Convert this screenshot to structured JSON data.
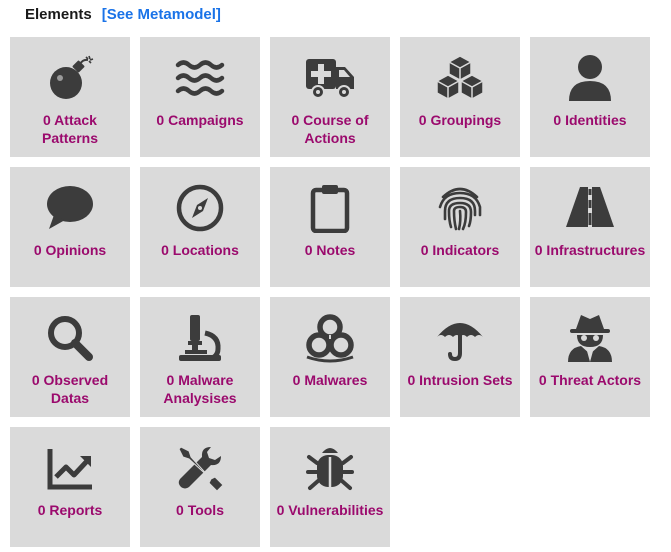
{
  "header": {
    "title": "Elements",
    "metamodel_link": "[See Metamodel]"
  },
  "tiles": [
    {
      "label": "0 Attack\nPatterns",
      "icon": "bomb-icon"
    },
    {
      "label": "0 Campaigns",
      "icon": "waves-icon"
    },
    {
      "label": "0 Course of\nActions",
      "icon": "ambulance-icon"
    },
    {
      "label": "0 Groupings",
      "icon": "cubes-icon"
    },
    {
      "label": "0 Identities",
      "icon": "user-icon"
    },
    {
      "label": "0 Opinions",
      "icon": "speech-bubble-icon"
    },
    {
      "label": "0 Locations",
      "icon": "compass-icon"
    },
    {
      "label": "0 Notes",
      "icon": "clipboard-icon"
    },
    {
      "label": "0 Indicators",
      "icon": "fingerprint-icon"
    },
    {
      "label": "0 Infrastructures",
      "icon": "road-icon"
    },
    {
      "label": "0 Observed\nDatas",
      "icon": "magnifier-icon"
    },
    {
      "label": "0 Malware\nAnalysises",
      "icon": "microscope-icon"
    },
    {
      "label": "0 Malwares",
      "icon": "biohazard-icon"
    },
    {
      "label": "0 Intrusion Sets",
      "icon": "umbrella-icon"
    },
    {
      "label": "0 Threat Actors",
      "icon": "spy-icon"
    },
    {
      "label": "0 Reports",
      "icon": "chart-line-icon"
    },
    {
      "label": "0 Tools",
      "icon": "tools-icon"
    },
    {
      "label": "0 Vulnerabilities",
      "icon": "bug-icon"
    }
  ],
  "colors": {
    "tile_bg": "#dadada",
    "label": "#9b0a6d",
    "icon": "#3c3c3c",
    "link": "#1a73e8"
  }
}
